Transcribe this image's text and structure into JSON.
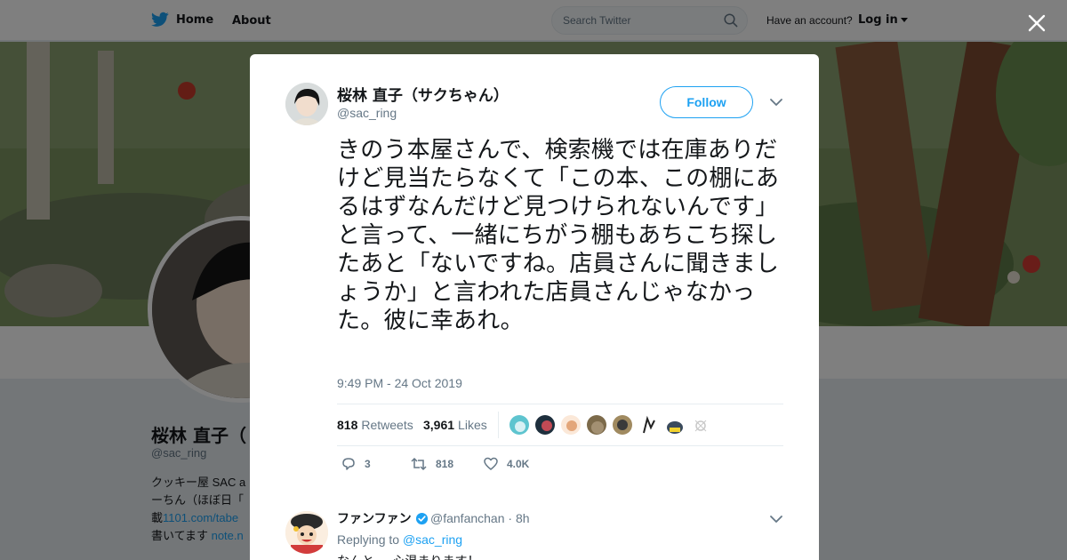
{
  "topbar": {
    "home_label": "Home",
    "about_label": "About",
    "search_placeholder": "Search Twitter",
    "have_account": "Have an account?",
    "login_label": "Log in"
  },
  "profile": {
    "name": "桜林 直子（",
    "handle": "@sac_ring",
    "bio_line1": "クッキー屋 SAC a",
    "bio_line2": "ーちん（ほぼ日「",
    "bio_line3_prefix": "載",
    "bio_line3_link": "1101.com/tabe",
    "bio_line4_prefix": "書いてます",
    "bio_line4_link": "note.n"
  },
  "tweet": {
    "author_name": "桜林 直子（サクちゃん）",
    "author_handle": "@sac_ring",
    "follow_label": "Follow",
    "text": "きのう本屋さんで、検索機では在庫ありだけど見当たらなくて「この本、この棚にあるはずなんだけど見つけられないんです」と言って、一緒にちがう棚もあちこち探したあと「ないですね。店員さんに聞きましょうか」と言われた店員さんじゃなかった。彼に幸あれ。",
    "timestamp": "9:49 PM - 24 Oct 2019",
    "retweets_count": "818",
    "retweets_label": "Retweets",
    "likes_count": "3,961",
    "likes_label": "Likes",
    "reply_count": "3",
    "retweet_count_action": "818",
    "like_count_action": "4.0K"
  },
  "reply": {
    "name": "ファンファン",
    "handle": "@fanfanchan",
    "time": "· 8h",
    "replying_prefix": "Replying to",
    "replying_to": "@sac_ring",
    "text": "なんと、、心温まります！"
  },
  "colors": {
    "accent": "#1da1f2",
    "text": "#14171a",
    "muted": "#657786",
    "border": "#e6ecf0"
  },
  "icons": [
    "twitter-bird-icon",
    "search-icon",
    "close-icon",
    "chevron-down-icon",
    "reply-icon",
    "retweet-icon",
    "heart-icon",
    "verified-icon"
  ]
}
